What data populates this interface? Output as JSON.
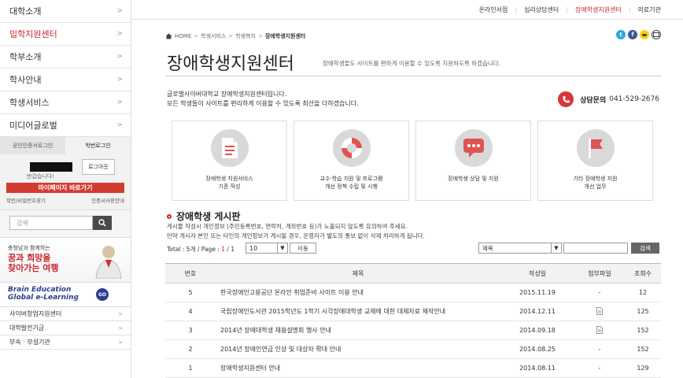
{
  "sidebar": {
    "menu": [
      {
        "label": "대학소개",
        "active": false
      },
      {
        "label": "입학지원센터",
        "active": true
      },
      {
        "label": "학부소개",
        "active": false
      },
      {
        "label": "학사안내",
        "active": false
      },
      {
        "label": "학생서비스",
        "active": false
      },
      {
        "label": "미디어글로벌",
        "active": false
      }
    ],
    "login": {
      "tab_cert": "공인인증서로그인",
      "tab_id": "학번로그인",
      "greeting": "반갑습니다!",
      "logout": "로그아웃",
      "mypage": "마이페이지 바로가기",
      "find_link": "학번/비밀번호찾기",
      "cert_link": "인증서사용안내"
    },
    "search_placeholder": "검색",
    "banner": {
      "small": "충청남과 함께하는",
      "big1": "꿈과 희망을",
      "big2": "찾아가는 여행"
    },
    "brain": {
      "line1": "Brain Education",
      "line2": "Global e-Learning",
      "go": "GO"
    },
    "submenu": [
      "사이버창업지원센터",
      "대학발전기금",
      "부속 · 부설기관"
    ]
  },
  "topbar": {
    "links": [
      {
        "label": "온라인서점",
        "active": false
      },
      {
        "label": "심리상담센터",
        "active": false
      },
      {
        "label": "장애학생지원센터",
        "active": true
      },
      {
        "label": "의료기관",
        "active": false
      }
    ]
  },
  "breadcrumb": [
    "HOME",
    "학생서비스",
    "학생복지",
    "장애학생지원센터"
  ],
  "page": {
    "title": "장애학생지원센터",
    "desc": "장애학생들도 사이트를 편하게 이용할 수 있도록 지원하도록 하겠습니다.",
    "intro1": "글로벌사이버대학교 장애학생지원센터입니다.",
    "intro2": "모든 학생들이 사이트를 편리하게 이용할 수 있도록 최선을 다하겠습니다.",
    "contact_label": "상담문의",
    "contact_number": "041-529-2676"
  },
  "cards": [
    {
      "icon": "document-icon",
      "line1": "장애학생 지원서비스",
      "line2": "기준 작성"
    },
    {
      "icon": "lifebuoy-icon",
      "line1": "교수·학습 지원 및 프로그램",
      "line2": "개선 정책 수립 및 시행"
    },
    {
      "icon": "chat-icon",
      "line1": "장애학생 상담 및 지원",
      "line2": ""
    },
    {
      "icon": "flag-icon",
      "line1": "기타 장애학생 지원",
      "line2": "개선 업무"
    }
  ],
  "board": {
    "title": "장애학생 게시판",
    "notice1": "게시물 작성시 개인정보 (주민등록번호, 연락처, 계좌번호 등)가 노출되지 않도록 유의하여 주세요.",
    "notice2": "만약 게시자 본인 또는 타인의 개인정보가 게시될 경우, 운영자가 별도의 통보 없이 삭제 처리하게 됩니다.",
    "total_prefix": "Total : 5개 / Page : ",
    "page_current": "1",
    "page_total": " / 1",
    "per_page": "10",
    "move": "이동",
    "search_field": "제목",
    "search_btn": "검색",
    "headers": {
      "num": "번호",
      "title": "제목",
      "date": "작성일",
      "file": "첨부파일",
      "views": "조회수"
    },
    "rows": [
      {
        "num": "5",
        "title": "한국장애인고용공단 온라인 취업준비 사이트 이용 안내",
        "date": "2015.11.19",
        "file": "-",
        "views": "12"
      },
      {
        "num": "4",
        "title": "국립장애인도서관 2015학년도 1학기 시각장애대학생 교재에 대한 대체자료 제작안내",
        "date": "2014.12.11",
        "file": "attachment",
        "views": "125"
      },
      {
        "num": "3",
        "title": "2014년 장애대학생 채용설명회 행사 안내",
        "date": "2014.09.18",
        "file": "attachment",
        "views": "152"
      },
      {
        "num": "2",
        "title": "2014년 장애인연금 인상 및 대상자 확대 안내",
        "date": "2014.08.25",
        "file": "-",
        "views": "152"
      },
      {
        "num": "1",
        "title": "장애학생지원센터 안내",
        "date": "2014.08.11",
        "file": "-",
        "views": "129"
      }
    ]
  },
  "colors": {
    "accent": "#c8252b",
    "button_dark": "#666666"
  }
}
